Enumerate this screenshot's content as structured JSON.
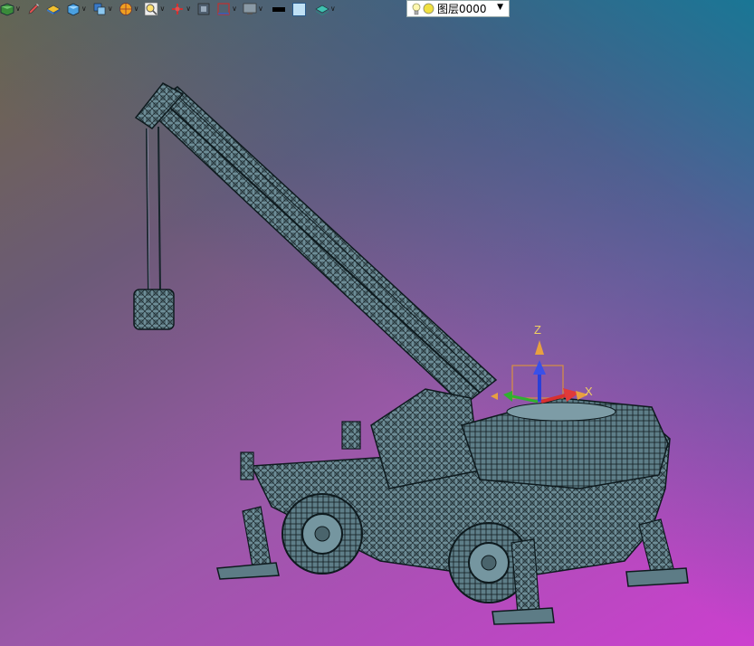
{
  "toolbar": {
    "buttons": [
      {
        "icon": "cube-green-icon"
      },
      {
        "icon": "pencil-icon"
      },
      {
        "icon": "surface-icon"
      },
      {
        "icon": "solid-box-icon"
      },
      {
        "icon": "views-icon"
      },
      {
        "icon": "section-icon"
      },
      {
        "icon": "zoom-icon"
      },
      {
        "icon": "snap-icon"
      },
      {
        "icon": "screen-icon"
      },
      {
        "icon": "dimension-icon"
      },
      {
        "icon": "display-icon"
      },
      {
        "icon": "color-black-swatch"
      },
      {
        "icon": "color-blue-swatch"
      },
      {
        "icon": "layer-stack-icon"
      }
    ],
    "layer_selector": {
      "value": "图层0000"
    }
  },
  "triad": {
    "z_label": "Z",
    "x_label": "X"
  },
  "colors": {
    "model_fill": "#6a8a94",
    "model_edge": "#0e1a1e",
    "z_axis": "#2a40d8",
    "x_axis": "#d83030",
    "y_axis": "#30b030"
  }
}
